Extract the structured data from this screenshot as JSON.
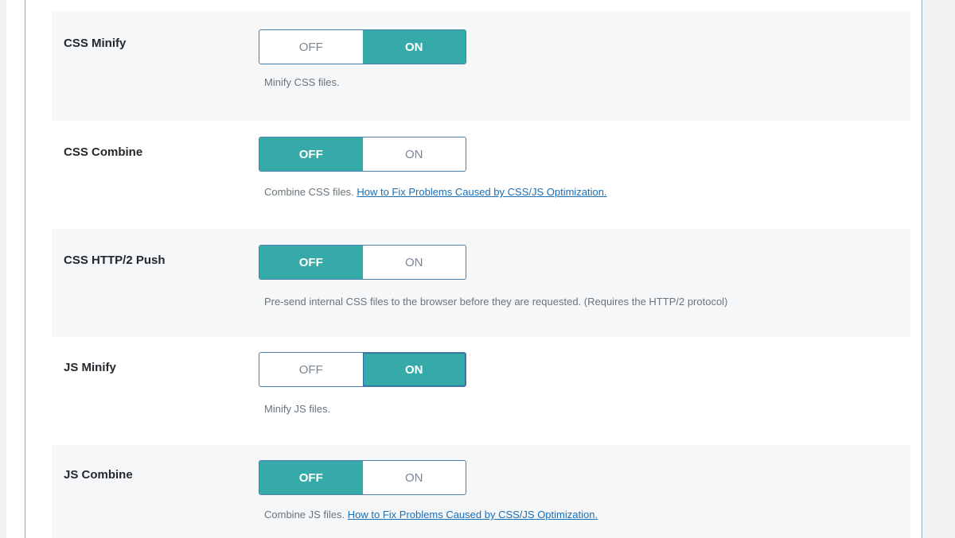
{
  "colors": {
    "accent": "#36aaa9",
    "border": "#4d7fae",
    "link": "#1a6eb5"
  },
  "settings": [
    {
      "label": "CSS Minify",
      "off_label": "OFF",
      "on_label": "ON",
      "state": "on",
      "description": "Minify CSS files.",
      "link": ""
    },
    {
      "label": "CSS Combine",
      "off_label": "OFF",
      "on_label": "ON",
      "state": "off",
      "description": "Combine CSS files.",
      "link": "How to Fix Problems Caused by CSS/JS Optimization."
    },
    {
      "label": "CSS HTTP/2 Push",
      "off_label": "OFF",
      "on_label": "ON",
      "state": "off",
      "description": "Pre-send internal CSS files to the browser before they are requested. (Requires the HTTP/2 protocol)",
      "link": ""
    },
    {
      "label": "JS Minify",
      "off_label": "OFF",
      "on_label": "ON",
      "state": "on",
      "description": "Minify JS files.",
      "link": ""
    },
    {
      "label": "JS Combine",
      "off_label": "OFF",
      "on_label": "ON",
      "state": "off",
      "description": "Combine JS files.",
      "link": "How to Fix Problems Caused by CSS/JS Optimization."
    }
  ]
}
